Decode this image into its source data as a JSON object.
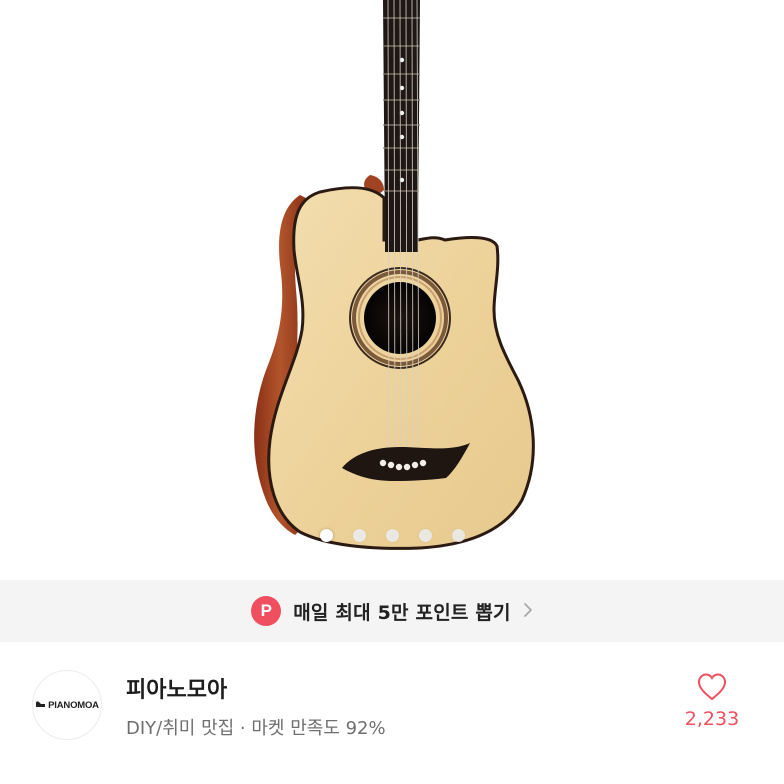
{
  "product_image": {
    "icon": "acoustic-guitar-photo",
    "carousel": {
      "count": 5,
      "active_index": 0
    }
  },
  "promo": {
    "badge": "P",
    "text": "매일 최대 5만 포인트 뽑기",
    "icon": "chevron-right-icon",
    "badge_color": "#ef4f5f"
  },
  "seller": {
    "logo_text": "PIANOMOA",
    "name": "피아노모아",
    "subtitle": "DIY/취미 맛집 · 마켓 만족도 92%"
  },
  "like": {
    "icon": "heart-outline-icon",
    "count": "2,233",
    "color": "#ef4f5f"
  }
}
